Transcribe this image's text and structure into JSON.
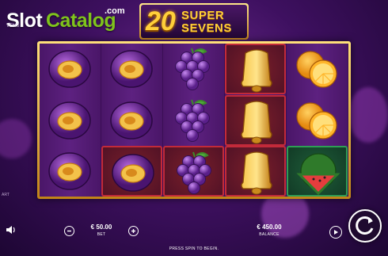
{
  "watermark": {
    "brand_left": "Slot",
    "brand_right": "Catalog",
    "suffix": ".com"
  },
  "game": {
    "title_number": "20",
    "title_line1": "SUPER",
    "title_line2": "SEVENS"
  },
  "reels": [
    [
      "plum",
      "plum",
      "plum"
    ],
    [
      "plum",
      "plum",
      "plum"
    ],
    [
      "grapes",
      "grapes",
      "grapes"
    ],
    [
      "bell",
      "bell",
      "bell"
    ],
    [
      "orange",
      "orange",
      "watermelon"
    ]
  ],
  "highlighted_cells": [
    [
      3,
      0
    ],
    [
      3,
      1
    ],
    [
      3,
      2
    ],
    [
      2,
      2
    ],
    [
      1,
      2
    ],
    [
      4,
      2
    ]
  ],
  "edge_text": {
    "top_left": "VENS",
    "side_left": "ART"
  },
  "controls": {
    "sound_icon": "speaker-icon",
    "bet": {
      "value": "€ 50.00",
      "label": "BET"
    },
    "balance": {
      "value": "€ 450.00",
      "label": "BALANCE"
    },
    "decrease_icon": "minus-icon",
    "increase_icon": "plus-icon",
    "autoplay_icon": "autoplay-icon",
    "spin_icon": "spin-icon",
    "message": "PRESS SPIN TO BEGIN."
  },
  "colors": {
    "frame_gold": "#e8b238",
    "win_red": "#c22a3a",
    "win_green": "#2f9e55",
    "background": "#3e1060"
  }
}
